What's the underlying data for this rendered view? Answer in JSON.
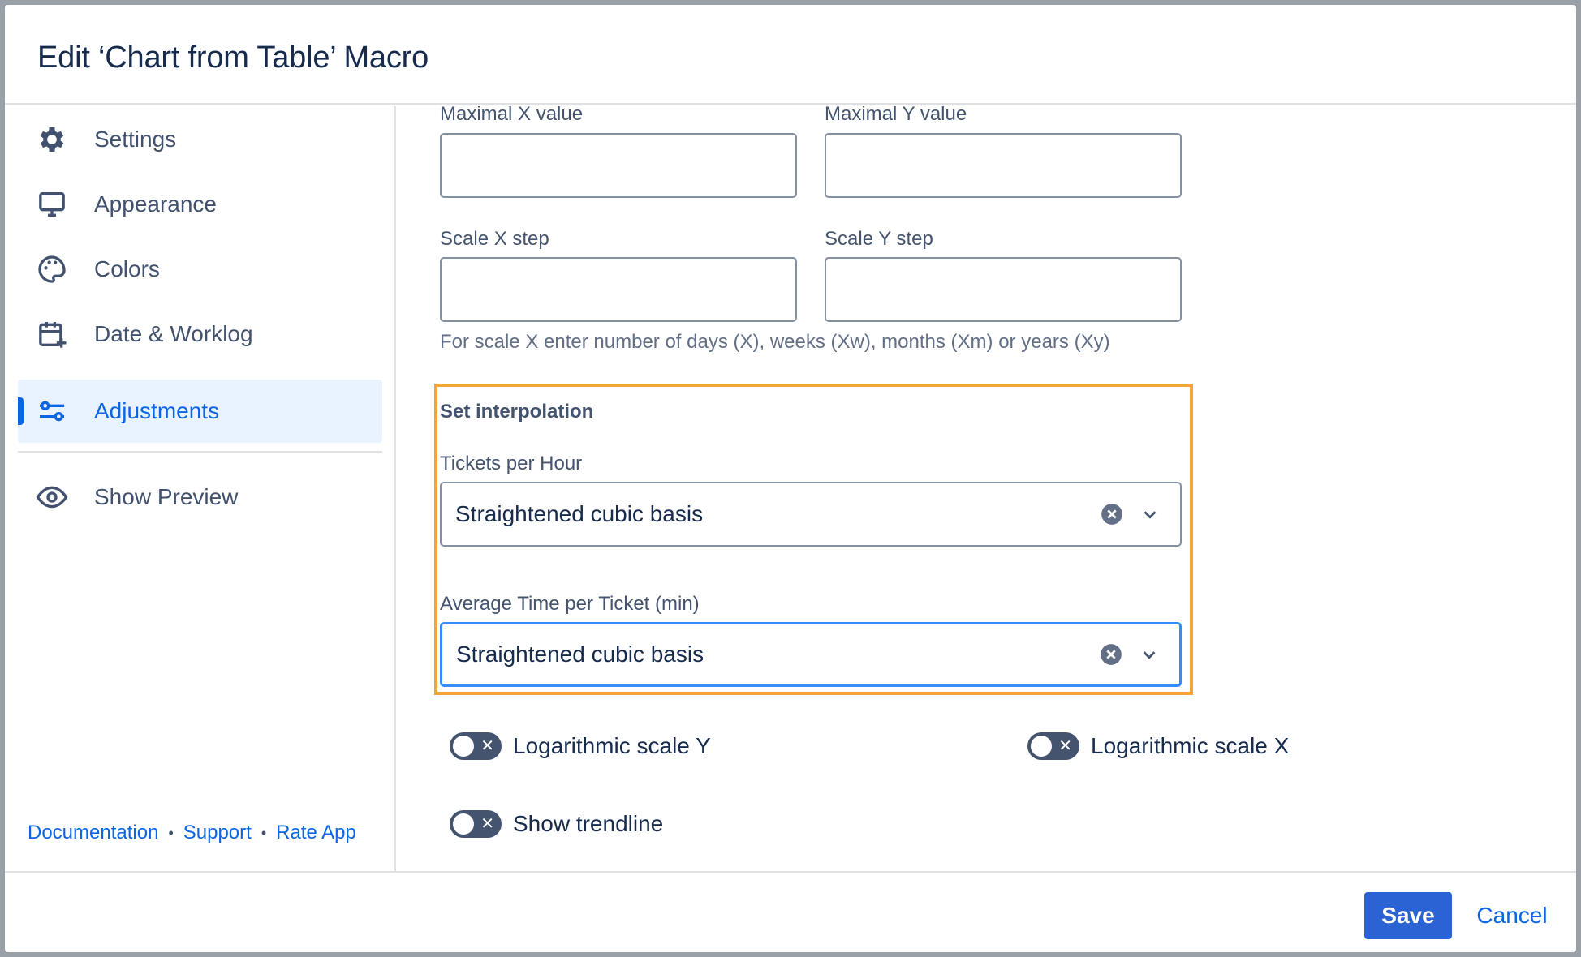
{
  "dialog": {
    "title": "Edit ‘Chart from Table’ Macro"
  },
  "sidebar": {
    "items": [
      {
        "label": "Settings",
        "icon": "gear-icon"
      },
      {
        "label": "Appearance",
        "icon": "monitor-icon"
      },
      {
        "label": "Colors",
        "icon": "palette-icon"
      },
      {
        "label": "Date & Worklog",
        "icon": "calendar-add-icon"
      },
      {
        "label": "Adjustments",
        "icon": "sliders-icon",
        "active": true
      }
    ],
    "preview": {
      "label": "Show Preview",
      "icon": "eye-icon"
    },
    "links": {
      "documentation": "Documentation",
      "support": "Support",
      "rate": "Rate App",
      "separator": "•"
    }
  },
  "form": {
    "max_x_label": "Maximal X value",
    "max_y_label": "Maximal Y value",
    "max_x_value": "",
    "max_y_value": "",
    "scale_x_label": "Scale X step",
    "scale_y_label": "Scale Y step",
    "scale_x_value": "",
    "scale_y_value": "",
    "scale_hint": "For scale X enter number of days (X), weeks (Xw), months (Xm) or years (Xy)",
    "interpolation": {
      "title": "Set interpolation",
      "series": [
        {
          "label": "Tickets per Hour",
          "value": "Straightened cubic basis"
        },
        {
          "label": "Average Time per Ticket (min)",
          "value": "Straightened cubic basis"
        }
      ]
    },
    "toggles": {
      "log_y": {
        "label": "Logarithmic scale Y",
        "on": false
      },
      "log_x": {
        "label": "Logarithmic scale X",
        "on": false
      },
      "trendline": {
        "label": "Show trendline",
        "on": false
      }
    }
  },
  "buttons": {
    "save": "Save",
    "cancel": "Cancel"
  },
  "colors": {
    "accent": "#0c66e4",
    "primary_button": "#2c63d4",
    "highlight_border": "#f4a53a"
  }
}
